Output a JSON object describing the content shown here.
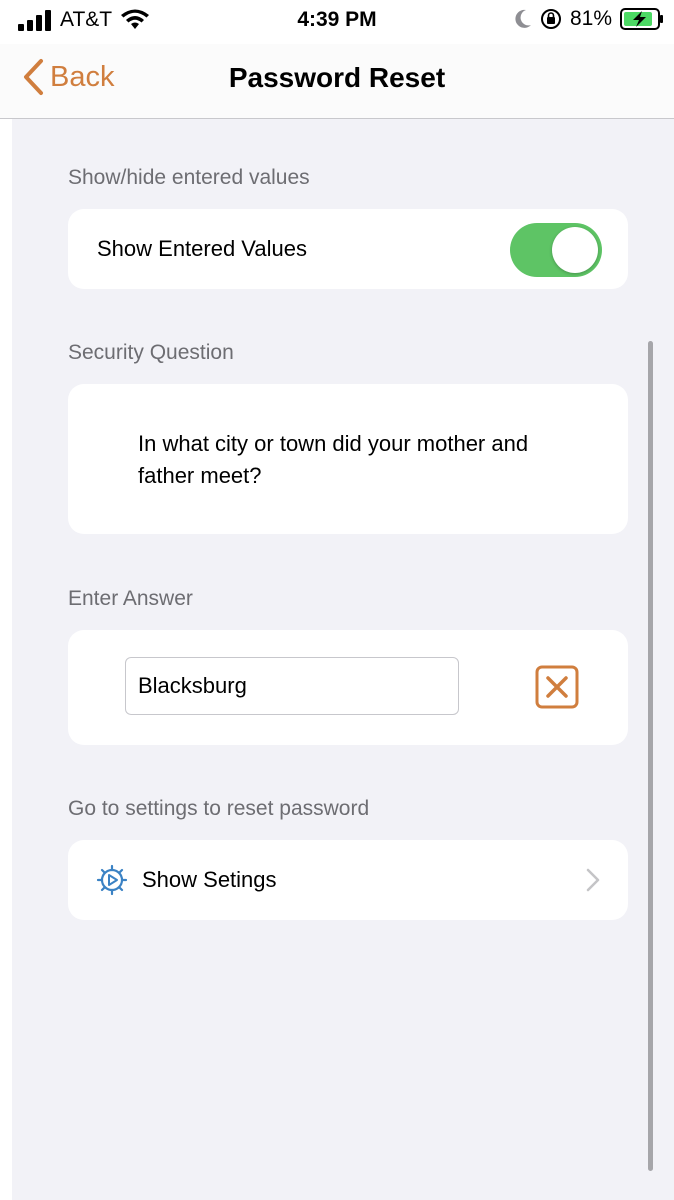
{
  "status_bar": {
    "carrier": "AT&T",
    "time": "4:39 PM",
    "battery_percent": "81%",
    "icons": [
      "signal-icon",
      "wifi-icon",
      "moon-icon",
      "orientation-lock-icon",
      "battery-charging-icon"
    ]
  },
  "nav": {
    "back_label": "Back",
    "title": "Password Reset"
  },
  "sections": {
    "show_hide": {
      "header": "Show/hide entered values",
      "row_label": "Show Entered Values",
      "toggle_on": true
    },
    "security_question": {
      "header": "Security Question",
      "question": "In what city or town did your mother and father meet?"
    },
    "answer": {
      "header": "Enter Answer",
      "value": "Blacksburg",
      "clear_icon": "clear-icon"
    },
    "settings": {
      "header": "Go to settings to reset password",
      "row_label": "Show Setings",
      "icon": "gear-icon"
    }
  },
  "colors": {
    "accent": "#d07e3e",
    "toggle_on": "#5ec465",
    "gear": "#3b82c4",
    "background": "#f2f2f7",
    "secondary_text": "#6d6d72"
  }
}
